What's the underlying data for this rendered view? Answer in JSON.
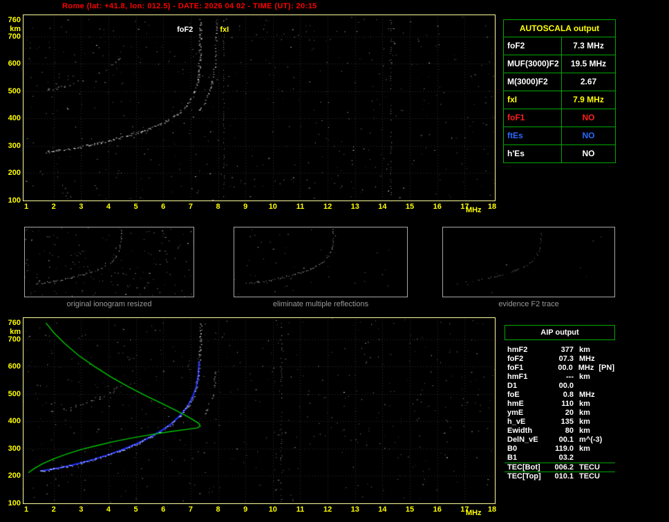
{
  "title": "Rome (lat: +41.8, lon: 012.5) - DATE: 2026 04 02 - TIME (UT): 20:15",
  "colors": {
    "title_red": "#ff0000",
    "axis_yellow": "#ffff00",
    "plot_border": "#ffffa0",
    "table_border": "#00aa00",
    "trace_blue": "#2233ff",
    "profile_green": "#00cc00",
    "caption_gray": "#9a9a9a"
  },
  "autoscala_table": {
    "title": "AUTOSCALA output",
    "rows": [
      {
        "label": "foF2",
        "value": "7.3 MHz",
        "color": "#ffffff"
      },
      {
        "label": "MUF(3000)F2",
        "value": "19.5 MHz",
        "color": "#ffffff"
      },
      {
        "label": "M(3000)F2",
        "value": "2.67",
        "color": "#ffffff"
      },
      {
        "label": "fxI",
        "value": "7.9 MHz",
        "color": "#ffff00"
      },
      {
        "label": "foF1",
        "value": "NO",
        "color": "#ff2020"
      },
      {
        "label": "ftEs",
        "value": "NO",
        "color": "#2a6aff"
      },
      {
        "label": "h'Es",
        "value": "NO",
        "color": "#ffffff"
      }
    ]
  },
  "thumbnails": [
    {
      "caption": "original ionogram resized"
    },
    {
      "caption": "eliminate multiple reflections"
    },
    {
      "caption": "evidence F2 trace"
    }
  ],
  "aip_table": {
    "title": "AIP output",
    "rows": [
      {
        "label": "hmF2",
        "value": "377",
        "unit": "km",
        "extra": "",
        "sep": false
      },
      {
        "label": "foF2",
        "value": "07.3",
        "unit": "MHz",
        "extra": "",
        "sep": false
      },
      {
        "label": "foF1",
        "value": "00.0",
        "unit": "MHz",
        "extra": "[PN]",
        "sep": false
      },
      {
        "label": "hmF1",
        "value": "---",
        "unit": "km",
        "extra": "",
        "sep": false
      },
      {
        "label": "D1",
        "value": "00.0",
        "unit": "",
        "extra": "",
        "sep": false
      },
      {
        "label": "foE",
        "value": "0.8",
        "unit": "MHz",
        "extra": "",
        "sep": false
      },
      {
        "label": "hmE",
        "value": "110",
        "unit": "km",
        "extra": "",
        "sep": false
      },
      {
        "label": "ymE",
        "value": "20",
        "unit": "km",
        "extra": "",
        "sep": false
      },
      {
        "label": "h_vE",
        "value": "135",
        "unit": "km",
        "extra": "",
        "sep": false
      },
      {
        "label": "Ewidth",
        "value": "80",
        "unit": "km",
        "extra": "",
        "sep": false
      },
      {
        "label": "DelN_vE",
        "value": "00.1",
        "unit": "m^(-3)",
        "extra": "",
        "sep": false
      },
      {
        "label": "B0",
        "value": "119.0",
        "unit": "km",
        "extra": "",
        "sep": false
      },
      {
        "label": "B1",
        "value": "03.2",
        "unit": "",
        "extra": "",
        "sep": false
      },
      {
        "label": "TEC[Bot]",
        "value": "006.2",
        "unit": "TECU",
        "extra": "",
        "sep": true
      },
      {
        "label": "TEC[Top]",
        "value": "010.1",
        "unit": "TECU",
        "extra": "",
        "sep": true
      }
    ]
  },
  "chart_data": [
    {
      "id": "recorded-ionogram",
      "type": "scatter",
      "title": "recorded ionogram",
      "xlabel": "MHz",
      "ylabel": "km",
      "xlim": [
        1,
        18
      ],
      "ylim": [
        100,
        760
      ],
      "x_ticks": [
        1,
        2,
        3,
        4,
        5,
        6,
        7,
        8,
        9,
        10,
        11,
        12,
        13,
        14,
        15,
        16,
        17,
        18
      ],
      "y_ticks": [
        760,
        700,
        600,
        500,
        400,
        300,
        200,
        100
      ],
      "grid": true,
      "seed": 1234,
      "noise": 520,
      "noise_columns": [
        8.2,
        14.3
      ],
      "readings": {
        "foF2_MHz": 7.3,
        "fxI_MHz": 7.9
      },
      "annotations": [
        {
          "text": "foF2",
          "f": 6.45,
          "km": 728,
          "color": "#ffffff"
        },
        {
          "text": "fxI",
          "f": 8.02,
          "km": 728,
          "color": "#ffff00"
        }
      ],
      "traces": [
        {
          "name": "second-hop-trace",
          "color": "#b8b8b8",
          "size": 2,
          "jitter": 2.4,
          "density": 0.4,
          "points": [
            [
              1.7,
              505
            ],
            [
              2.2,
              516
            ],
            [
              2.7,
              530
            ],
            [
              3.2,
              547
            ],
            [
              3.6,
              566
            ],
            [
              4.0,
              588
            ],
            [
              4.3,
              612
            ],
            [
              4.5,
              632
            ]
          ]
        },
        {
          "name": "F2-extraordinary-trace",
          "color": "#d8d8d8",
          "size": 2,
          "jitter": 1.2,
          "density": 0.6,
          "points": [
            [
              7.1,
              408
            ],
            [
              7.3,
              430
            ],
            [
              7.5,
              458
            ],
            [
              7.65,
              492
            ],
            [
              7.78,
              535
            ],
            [
              7.86,
              590
            ],
            [
              7.9,
              650
            ],
            [
              7.92,
              760
            ]
          ]
        },
        {
          "name": "F2-ordinary-trace",
          "color": "#ffffff",
          "size": 2,
          "jitter": 1.6,
          "density": 0.85,
          "points": [
            [
              1.7,
              278
            ],
            [
              2.2,
              284
            ],
            [
              2.7,
              292
            ],
            [
              3.2,
              301
            ],
            [
              3.7,
              312
            ],
            [
              4.2,
              324
            ],
            [
              4.7,
              338
            ],
            [
              5.2,
              354
            ],
            [
              5.7,
              372
            ],
            [
              6.1,
              392
            ],
            [
              6.5,
              416
            ],
            [
              6.8,
              442
            ],
            [
              7.0,
              468
            ],
            [
              7.15,
              500
            ],
            [
              7.25,
              540
            ],
            [
              7.3,
              590
            ],
            [
              7.33,
              650
            ],
            [
              7.34,
              760
            ]
          ]
        }
      ]
    },
    {
      "id": "interpreted-ionogram",
      "type": "scatter",
      "title": "ionogram with restored trace and electron density profile",
      "xlabel": "MHz",
      "ylabel": "km",
      "xlim": [
        1,
        18
      ],
      "ylim": [
        100,
        760
      ],
      "x_ticks": [
        1,
        2,
        3,
        4,
        5,
        6,
        7,
        8,
        9,
        10,
        11,
        12,
        13,
        14,
        15,
        16,
        17,
        18
      ],
      "y_ticks": [
        760,
        700,
        600,
        500,
        400,
        300,
        200,
        100
      ],
      "grid": true,
      "seed": 4321,
      "noise": 500,
      "noise_columns": [
        10.3
      ],
      "annotations": [],
      "fitted_color": "#2233ff",
      "fitted": [
        [
          1.5,
          218
        ],
        [
          2.0,
          226
        ],
        [
          2.5,
          236
        ],
        [
          3.0,
          248
        ],
        [
          3.5,
          262
        ],
        [
          4.0,
          278
        ],
        [
          4.5,
          296
        ],
        [
          5.0,
          317
        ],
        [
          5.5,
          341
        ],
        [
          5.9,
          364
        ],
        [
          6.3,
          392
        ],
        [
          6.6,
          420
        ],
        [
          6.85,
          450
        ],
        [
          7.05,
          485
        ],
        [
          7.2,
          525
        ],
        [
          7.28,
          570
        ],
        [
          7.3,
          620
        ]
      ],
      "profile_color": "#00cc00",
      "profile": [
        [
          1.08,
          212
        ],
        [
          1.3,
          228
        ],
        [
          1.6,
          245
        ],
        [
          2.0,
          263
        ],
        [
          2.5,
          281
        ],
        [
          3.0,
          297
        ],
        [
          3.6,
          312
        ],
        [
          4.2,
          326
        ],
        [
          4.9,
          340
        ],
        [
          5.6,
          352
        ],
        [
          6.3,
          363
        ],
        [
          6.9,
          371
        ],
        [
          7.25,
          376
        ],
        [
          7.35,
          383
        ],
        [
          7.3,
          392
        ],
        [
          7.1,
          405
        ],
        [
          6.8,
          422
        ],
        [
          6.4,
          443
        ],
        [
          5.9,
          468
        ],
        [
          5.3,
          497
        ],
        [
          4.7,
          528
        ],
        [
          4.1,
          562
        ],
        [
          3.5,
          600
        ],
        [
          2.9,
          642
        ],
        [
          2.4,
          685
        ],
        [
          2.0,
          725
        ],
        [
          1.72,
          760
        ]
      ],
      "traces": [
        {
          "name": "second-hop-trace",
          "color": "#b8b8b8",
          "size": 2,
          "jitter": 2.2,
          "density": 0.38,
          "points": [
            [
              1.8,
              432
            ],
            [
              2.3,
              443
            ],
            [
              2.8,
              457
            ],
            [
              3.3,
              474
            ],
            [
              3.8,
              494
            ],
            [
              4.2,
              516
            ],
            [
              4.6,
              542
            ]
          ]
        },
        {
          "name": "F2-extraordinary-trace",
          "color": "#d0d0d0",
          "size": 2,
          "jitter": 1.4,
          "density": 0.5,
          "points": [
            [
              7.45,
              420
            ],
            [
              7.6,
              448
            ],
            [
              7.75,
              485
            ],
            [
              7.85,
              530
            ],
            [
              7.9,
              580
            ]
          ]
        },
        {
          "name": "F2-ordinary-trace",
          "color": "#ffffff",
          "size": 2,
          "jitter": 1.5,
          "density": 0.8,
          "points": [
            [
              1.5,
              218
            ],
            [
              2.0,
              226
            ],
            [
              2.5,
              236
            ],
            [
              3.0,
              248
            ],
            [
              3.5,
              262
            ],
            [
              4.0,
              278
            ],
            [
              4.5,
              296
            ],
            [
              5.0,
              317
            ],
            [
              5.5,
              341
            ],
            [
              5.9,
              364
            ],
            [
              6.3,
              392
            ],
            [
              6.6,
              420
            ],
            [
              6.85,
              450
            ],
            [
              7.05,
              485
            ],
            [
              7.2,
              525
            ],
            [
              7.28,
              570
            ],
            [
              7.32,
              625
            ],
            [
              7.34,
              700
            ],
            [
              7.35,
              760
            ]
          ]
        }
      ]
    },
    {
      "id": "thumb-original",
      "type": "scatter",
      "xlim": [
        1,
        12
      ],
      "ylim": [
        100,
        760
      ],
      "grid": false,
      "seed": 7,
      "noise": 170,
      "traces": [
        {
          "name": "second-hop-trace",
          "color": "#c0c0c0",
          "size": 1,
          "jitter": 1.5,
          "density": 0.35,
          "points": [
            [
              1.8,
              450
            ],
            [
              2.6,
              470
            ],
            [
              3.4,
              495
            ],
            [
              4.2,
              525
            ],
            [
              4.8,
              555
            ]
          ]
        },
        {
          "name": "F2-trace",
          "color": "#ffffff",
          "size": 1,
          "jitter": 1.2,
          "density": 0.7,
          "points": [
            [
              1.6,
              230
            ],
            [
              2.4,
              245
            ],
            [
              3.2,
              265
            ],
            [
              4.0,
              290
            ],
            [
              4.8,
              320
            ],
            [
              5.6,
              358
            ],
            [
              6.2,
              398
            ],
            [
              6.7,
              445
            ],
            [
              7.0,
              500
            ],
            [
              7.2,
              570
            ],
            [
              7.3,
              650
            ],
            [
              7.3,
              758
            ]
          ]
        }
      ]
    },
    {
      "id": "thumb-no-multiples",
      "type": "scatter",
      "xlim": [
        1,
        12
      ],
      "ylim": [
        100,
        760
      ],
      "grid": false,
      "seed": 8,
      "noise": 45,
      "traces": [
        {
          "name": "second-hop-remnant",
          "color": "#8a8a8a",
          "size": 1,
          "jitter": 1.2,
          "density": 0.15,
          "points": [
            [
              1.8,
              450
            ],
            [
              2.6,
              470
            ],
            [
              3.4,
              495
            ],
            [
              4.2,
              525
            ]
          ]
        },
        {
          "name": "F2-trace",
          "color": "#ffffff",
          "size": 1,
          "jitter": 1.1,
          "density": 0.7,
          "points": [
            [
              1.6,
              230
            ],
            [
              2.4,
              245
            ],
            [
              3.2,
              265
            ],
            [
              4.0,
              290
            ],
            [
              4.8,
              320
            ],
            [
              5.6,
              358
            ],
            [
              6.2,
              398
            ],
            [
              6.7,
              445
            ],
            [
              7.0,
              500
            ],
            [
              7.2,
              570
            ],
            [
              7.3,
              650
            ],
            [
              7.3,
              758
            ]
          ]
        }
      ]
    },
    {
      "id": "thumb-f2-trace",
      "type": "scatter",
      "xlim": [
        1,
        12
      ],
      "ylim": [
        100,
        760
      ],
      "grid": false,
      "seed": 9,
      "noise": 10,
      "traces": [
        {
          "name": "F2-trace",
          "color": "#a8a8a8",
          "size": 1,
          "jitter": 1.0,
          "density": 0.5,
          "points": [
            [
              1.6,
              230
            ],
            [
              2.4,
              245
            ],
            [
              3.2,
              265
            ],
            [
              4.0,
              290
            ],
            [
              4.8,
              320
            ],
            [
              5.6,
              358
            ],
            [
              6.2,
              398
            ],
            [
              6.7,
              445
            ],
            [
              7.0,
              500
            ],
            [
              7.2,
              570
            ],
            [
              7.3,
              650
            ],
            [
              7.3,
              758
            ]
          ]
        }
      ]
    }
  ]
}
